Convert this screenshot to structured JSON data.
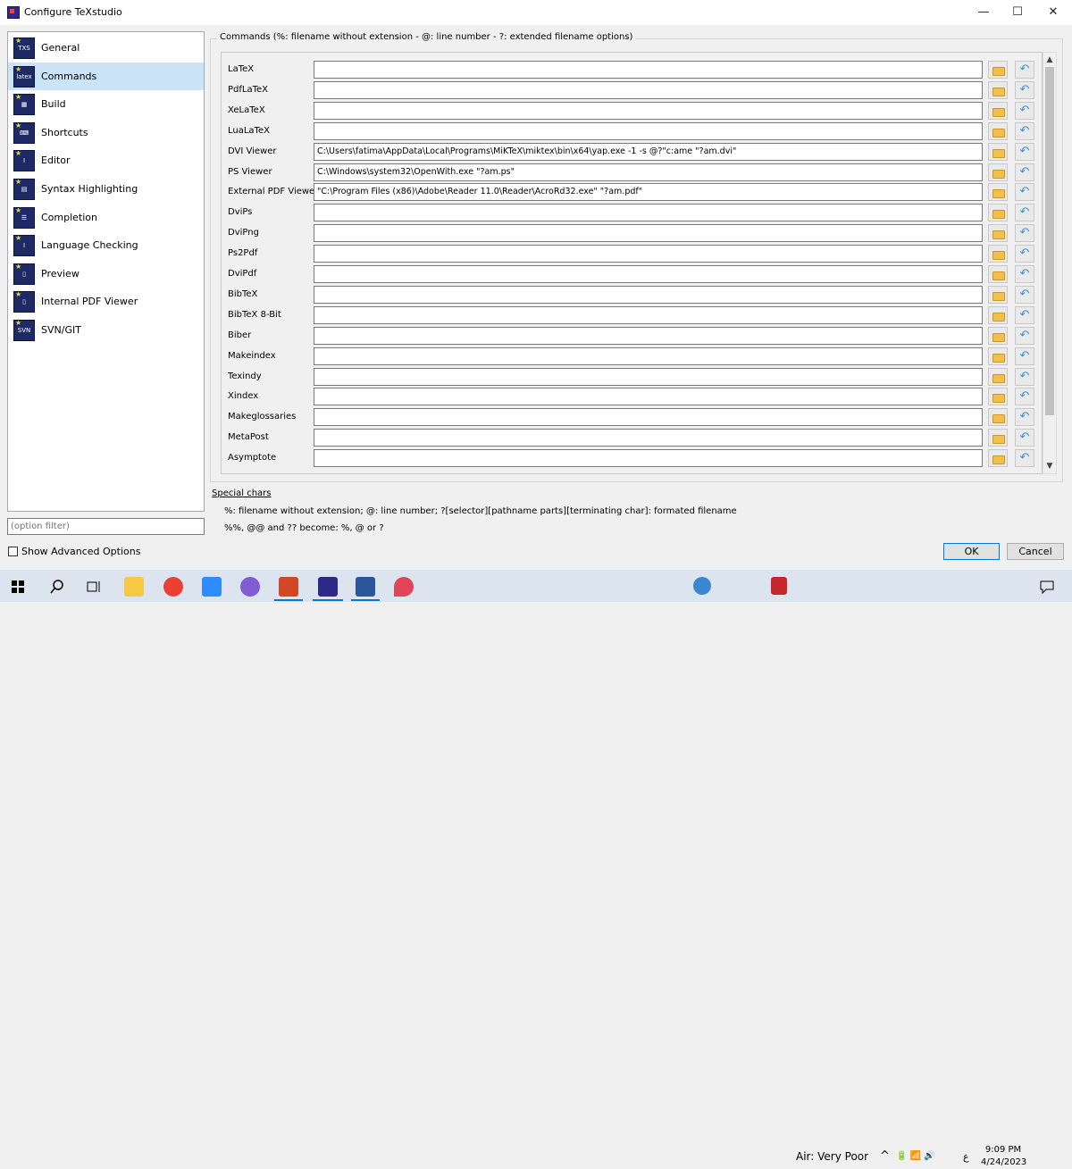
{
  "window": {
    "title": "Configure TeXstudio",
    "minimize_glyph": "—",
    "maximize_glyph": "☐",
    "close_glyph": "✕"
  },
  "sidebar": {
    "items": [
      {
        "label": "General",
        "icon": "txs-icon",
        "icon_text": "TXS"
      },
      {
        "label": "Commands",
        "icon": "latex-icon",
        "icon_text": "latex",
        "selected": true
      },
      {
        "label": "Build",
        "icon": "build-icon",
        "icon_text": "▦"
      },
      {
        "label": "Shortcuts",
        "icon": "keyboard-icon",
        "icon_text": "⌨"
      },
      {
        "label": "Editor",
        "icon": "editor-icon",
        "icon_text": "I"
      },
      {
        "label": "Syntax Highlighting",
        "icon": "syntax-icon",
        "icon_text": "▤"
      },
      {
        "label": "Completion",
        "icon": "completion-icon",
        "icon_text": "☰"
      },
      {
        "label": "Language Checking",
        "icon": "language-icon",
        "icon_text": "I"
      },
      {
        "label": "Preview",
        "icon": "preview-icon",
        "icon_text": "▯"
      },
      {
        "label": "Internal PDF Viewer",
        "icon": "pdf-viewer-icon",
        "icon_text": "▯"
      },
      {
        "label": "SVN/GIT",
        "icon": "svn-icon",
        "icon_text": "SVN"
      }
    ],
    "filter_placeholder": "(option filter)",
    "show_advanced_label": "Show Advanced Options"
  },
  "commands": {
    "group_title": "Commands (%: filename without extension - @: line number - ?: extended filename options)",
    "reset_glyph": "↶",
    "rows": [
      {
        "label": "LaTeX",
        "value": ""
      },
      {
        "label": "PdfLaTeX",
        "value": ""
      },
      {
        "label": "XeLaTeX",
        "value": ""
      },
      {
        "label": "LuaLaTeX",
        "value": ""
      },
      {
        "label": "DVI Viewer",
        "value": "C:\\Users\\fatima\\AppData\\Local\\Programs\\MiKTeX\\miktex\\bin\\x64\\yap.exe -1 -s @?\"c:ame \"?am.dvi\""
      },
      {
        "label": "PS Viewer",
        "value": "C:\\Windows\\system32\\OpenWith.exe \"?am.ps\""
      },
      {
        "label": "External PDF Viewer",
        "value": "\"C:\\Program Files (x86)\\Adobe\\Reader 11.0\\Reader\\AcroRd32.exe\" \"?am.pdf\""
      },
      {
        "label": "DviPs",
        "value": ""
      },
      {
        "label": "DviPng",
        "value": ""
      },
      {
        "label": "Ps2Pdf",
        "value": ""
      },
      {
        "label": "DviPdf",
        "value": ""
      },
      {
        "label": "BibTeX",
        "value": ""
      },
      {
        "label": "BibTeX 8-Bit",
        "value": ""
      },
      {
        "label": "Biber",
        "value": ""
      },
      {
        "label": "Makeindex",
        "value": ""
      },
      {
        "label": "Texindy",
        "value": ""
      },
      {
        "label": "Xindex",
        "value": ""
      },
      {
        "label": "Makeglossaries",
        "value": ""
      },
      {
        "label": "MetaPost",
        "value": ""
      },
      {
        "label": "Asymptote",
        "value": ""
      }
    ],
    "scroll_up_glyph": "▲",
    "scroll_down_glyph": "▼"
  },
  "special": {
    "title": "Special chars",
    "line1": "%: filename without extension; @: line number; ?[selector][pathname parts][terminating char]: formated filename",
    "line2": "%%, @@ and ?? become: %, @ or ?"
  },
  "buttons": {
    "ok": "OK",
    "cancel": "Cancel"
  },
  "taskbar": {
    "air_quality": "Air: Very Poor",
    "tray_chevron": "^",
    "tray_icons": "🔋 📶 🔊",
    "tray_lang": "ع",
    "time": "9:09 PM",
    "date": "4/24/2023"
  }
}
